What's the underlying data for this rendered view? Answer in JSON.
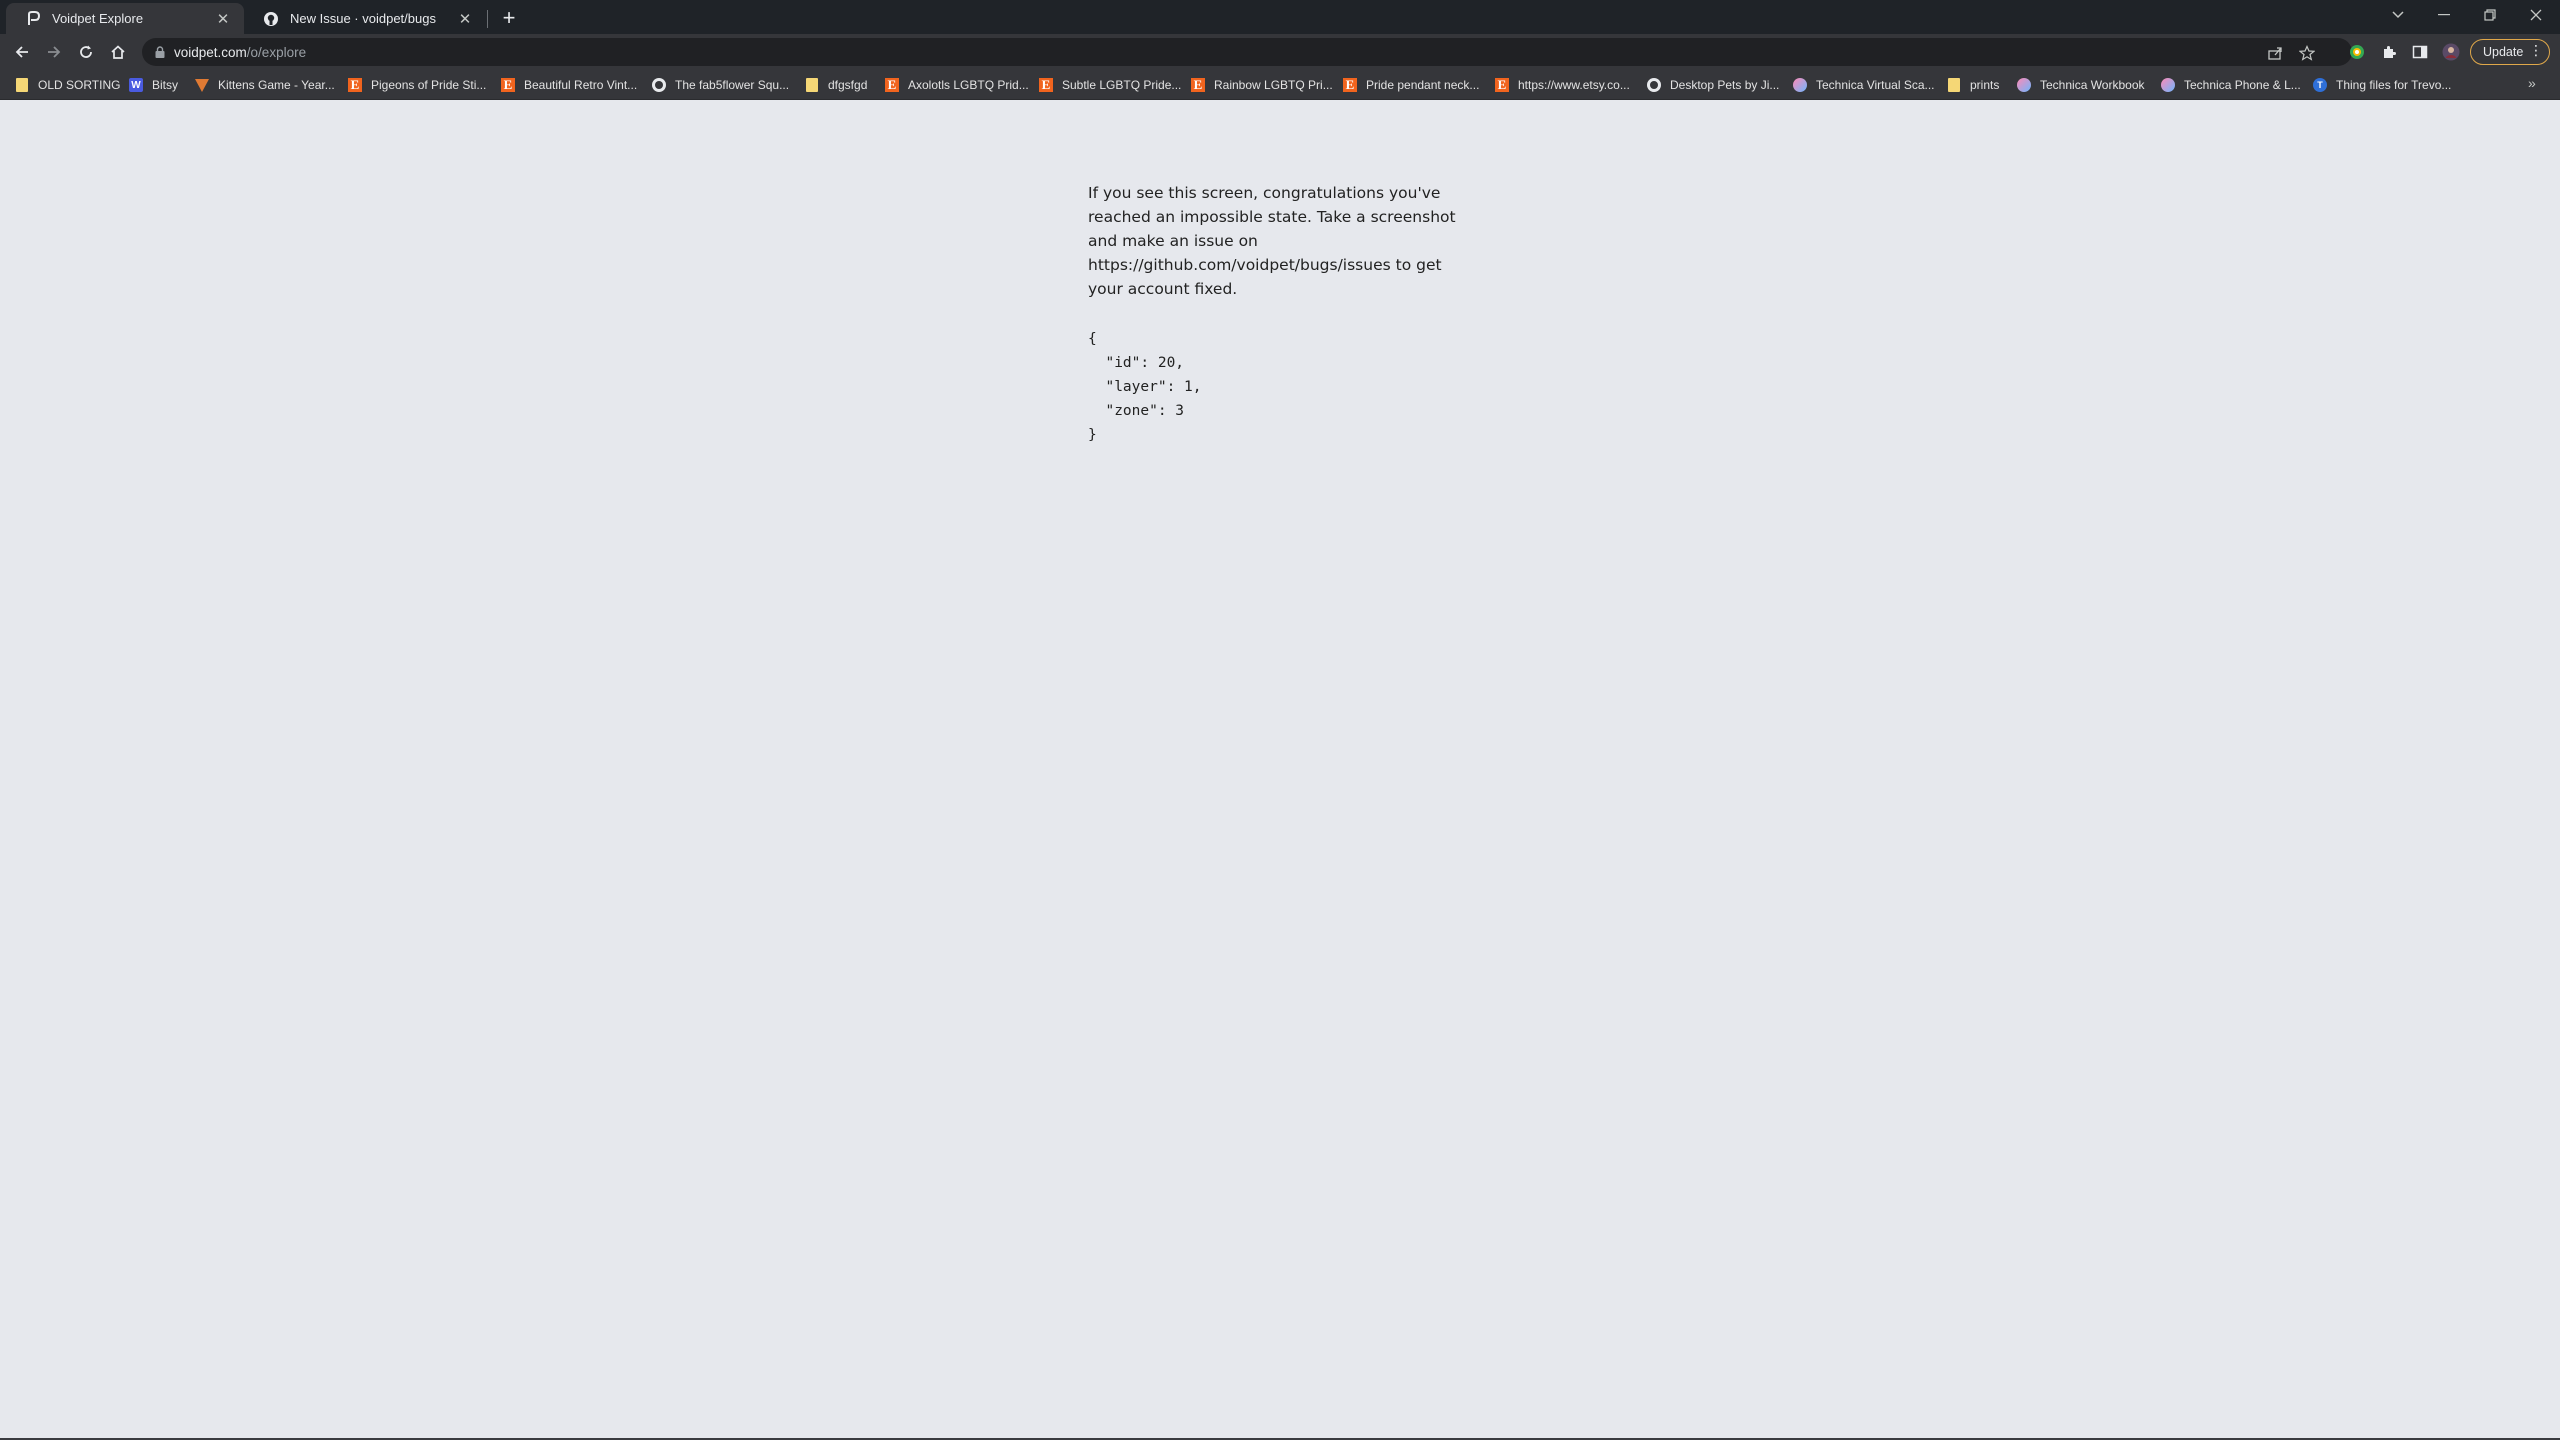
{
  "tabs": [
    {
      "title": "Voidpet Explore",
      "icon": "voidpet-icon",
      "active": true
    },
    {
      "title": "New Issue · voidpet/bugs",
      "icon": "github-icon",
      "active": false
    }
  ],
  "toolbar": {
    "url_host": "voidpet.com",
    "url_path": "/o/explore",
    "update_label": "Update"
  },
  "bookmarks": [
    {
      "label": "OLD SORTING",
      "icon": "folder-icon"
    },
    {
      "label": "Bitsy",
      "icon": "bitsy-icon"
    },
    {
      "label": "Kittens Game - Year...",
      "icon": "kittens-game-icon"
    },
    {
      "label": "Pigeons of Pride Sti...",
      "icon": "etsy-icon"
    },
    {
      "label": "Beautiful Retro Vint...",
      "icon": "etsy-icon"
    },
    {
      "label": "The fab5flower Squ...",
      "icon": "globe-icon"
    },
    {
      "label": "dfgsfgd",
      "icon": "folder-icon"
    },
    {
      "label": "Axolotls LGBTQ Prid...",
      "icon": "etsy-icon"
    },
    {
      "label": "Subtle LGBTQ Pride...",
      "icon": "etsy-icon"
    },
    {
      "label": "Rainbow LGBTQ Pri...",
      "icon": "etsy-icon"
    },
    {
      "label": "Pride pendant neck...",
      "icon": "etsy-icon"
    },
    {
      "label": "https://www.etsy.co...",
      "icon": "etsy-icon"
    },
    {
      "label": "Desktop Pets by Ji...",
      "icon": "globe-icon"
    },
    {
      "label": "Technica Virtual Sca...",
      "icon": "technica-icon"
    },
    {
      "label": "prints",
      "icon": "folder-icon"
    },
    {
      "label": "Technica Workbook",
      "icon": "technica-icon"
    },
    {
      "label": "Technica Phone & L...",
      "icon": "technica-icon"
    },
    {
      "label": "Thing files for Trevo...",
      "icon": "thingiverse-icon"
    }
  ],
  "page": {
    "message": "If you see this screen, congratulations you've reached an impossible state. Take a screenshot and make an issue on https://github.com/voidpet/bugs/issues to get your account fixed.",
    "json_text": "{\n  \"id\": 20,\n  \"layer\": 1,\n  \"zone\": 3\n}"
  }
}
